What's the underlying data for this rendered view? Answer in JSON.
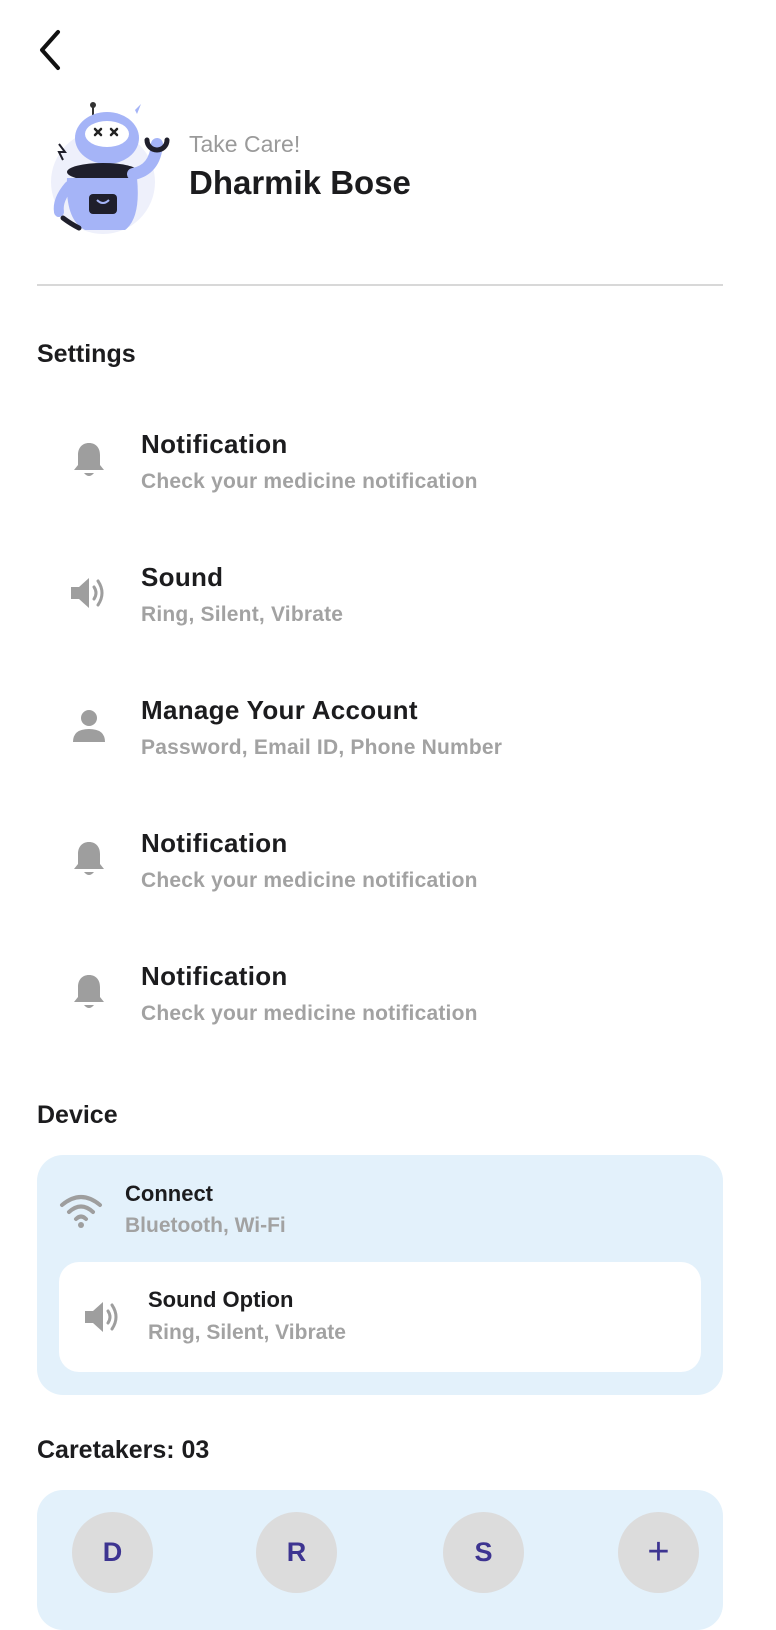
{
  "header": {
    "greeting": "Take Care!",
    "user_name": "Dharmik Bose",
    "back_icon": "chevron-left-icon",
    "avatar": "robot-mascot"
  },
  "settings": {
    "title": "Settings",
    "items": [
      {
        "icon": "bell-icon",
        "title": "Notification",
        "subtitle": "Check your medicine notification"
      },
      {
        "icon": "speaker-icon",
        "title": "Sound",
        "subtitle": "Ring, Silent, Vibrate"
      },
      {
        "icon": "person-icon",
        "title": "Manage Your Account",
        "subtitle": "Password, Email ID, Phone Number"
      },
      {
        "icon": "bell-icon",
        "title": "Notification",
        "subtitle": "Check your medicine notification"
      },
      {
        "icon": "bell-icon",
        "title": "Notification",
        "subtitle": "Check your medicine notification"
      }
    ]
  },
  "device": {
    "title": "Device",
    "connect": {
      "icon": "wifi-icon",
      "title": "Connect",
      "subtitle": "Bluetooth, Wi-Fi"
    },
    "sound_option": {
      "icon": "speaker-icon",
      "title": "Sound Option",
      "subtitle": "Ring, Silent, Vibrate"
    }
  },
  "caretakers": {
    "title": "Caretakers: 03",
    "members": [
      "D",
      "R",
      "S"
    ],
    "add_label": "+"
  },
  "colors": {
    "card_background": "#e3f1fb",
    "initials_text": "#3d3491",
    "icon_gray": "#9e9e9e",
    "subtitle_gray": "#a2a2a2",
    "avatar_purple": "#a5b4f7"
  }
}
